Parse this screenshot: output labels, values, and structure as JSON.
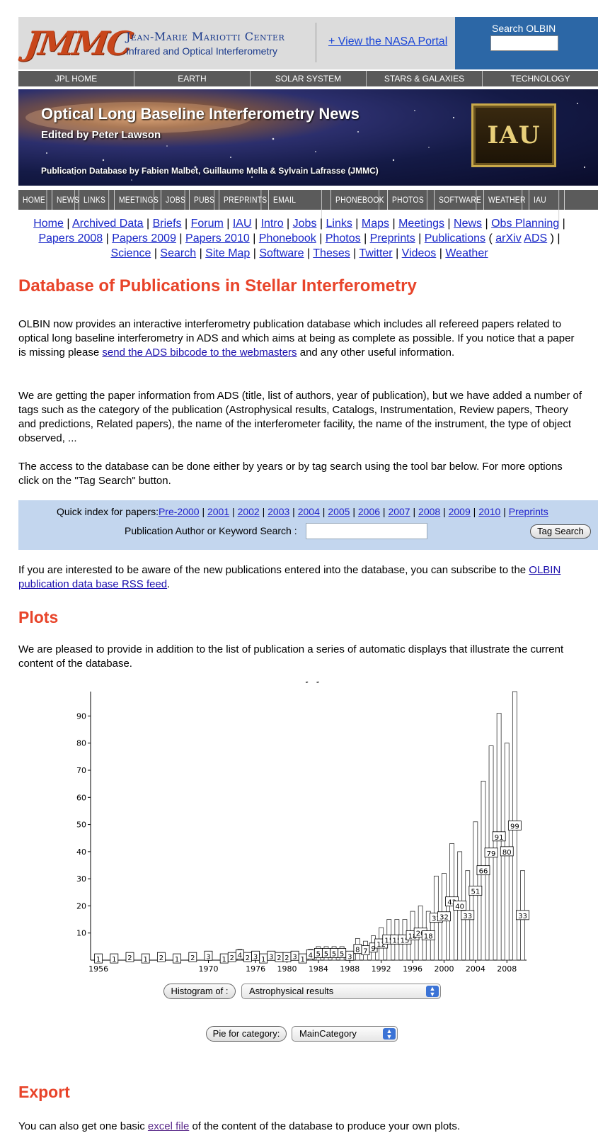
{
  "header": {
    "logo": "JMMC",
    "center_name": "Jean-Marie Mariotti Center",
    "center_subtitle": "Infrared and Optical Interferometry",
    "nasa_link": "+ View the NASA Portal",
    "search_label": "Search OLBIN"
  },
  "top_nav": [
    "JPL HOME",
    "EARTH",
    "SOLAR SYSTEM",
    "STARS & GALAXIES",
    "TECHNOLOGY"
  ],
  "banner": {
    "title": "Optical Long Baseline Interferometry News",
    "editor": "Edited by Peter Lawson",
    "publication_credit": "Publication Database by Fabien Malbet, Guillaume Mella & Sylvain Lafrasse (JMMC)",
    "badge": "IAU"
  },
  "nav2": [
    "HOME",
    "NEWS",
    "LINKS",
    "MEETINGS",
    "JOBS",
    "PUBS",
    "PREPRINTS",
    "EMAIL FORUM",
    "PHONEBOOK",
    "PHOTOS",
    "SOFTWARE",
    "WEATHER",
    "IAU WG"
  ],
  "quick_links": {
    "line1": [
      "Home",
      "Archived Data",
      "Briefs",
      "Forum",
      "IAU",
      "Intro",
      "Jobs",
      "Links",
      "Maps",
      "Meetings",
      "News",
      "Obs Planning"
    ],
    "line2": [
      "Papers 2008",
      "Papers 2009",
      "Papers 2010",
      "Phonebook",
      "Photos",
      "Preprints",
      "Publications"
    ],
    "line2_sub": [
      "arXiv",
      "ADS"
    ],
    "line3": [
      "Science",
      "Search",
      "Site Map",
      "Software",
      "Theses",
      "Twitter",
      "Videos",
      "Weather"
    ]
  },
  "main": {
    "title": "Database of Publications in Stellar Interferometry",
    "p1_before": "OLBIN now provides an interactive interferometry publication database which includes all refereed papers related to optical long baseline interferometry in ADS and which aims at being as complete as possible. If you notice that a paper is missing please ",
    "p1_link": "send the ADS bibcode to the webmasters",
    "p1_after": " and any other useful information.",
    "p2": "We are getting the paper information from ADS (title, list of authors, year of publication), but we have added a number of tags such as the category of the publication (Astrophysical results, Catalogs, Instrumentation, Review papers, Theory and predictions, Related papers), the name of the interferometer facility, the name of the instrument, the type of object observed, ...",
    "p3": "The access to the database can be done either by years or by tag search using the tool bar below. For more options click on the \"Tag Search\" button.",
    "toolbar": {
      "quick_index_label": "Quick index for papers:",
      "years": [
        "Pre-2000",
        "2001",
        "2002",
        "2003",
        "2004",
        "2005",
        "2006",
        "2007",
        "2008",
        "2009",
        "2010",
        "Preprints"
      ],
      "search_label": "Publication Author or Keyword Search :",
      "tag_search_button": "Tag Search"
    },
    "p4_before": "If you are interested to be aware of the new publications entered into the database, you can subscribe to the ",
    "p4_link": "OLBIN publication data base RSS feed",
    "p4_after": ".",
    "plots_title": "Plots",
    "p5": "We are pleased to provide in addition to the list of publication a series of automatic displays that illustrate the current content of the database.",
    "histogram_button": "Histogram of :",
    "histogram_select": "Astrophysical results",
    "pie_button": "Pie for category:",
    "pie_select": "MainCategory",
    "export_title": "Export",
    "p6_before": "You can also get one basic ",
    "p6_link": "excel file",
    "p6_after": " of the content of the database to produce your own plots."
  },
  "chart_data": {
    "type": "bar",
    "title": "Articles by years",
    "x": [
      1956,
      1958,
      1960,
      1962,
      1964,
      1966,
      1968,
      1970,
      1972,
      1973,
      1974,
      1975,
      1976,
      1977,
      1978,
      1979,
      1980,
      1981,
      1982,
      1983,
      1984,
      1985,
      1986,
      1987,
      1988,
      1989,
      1990,
      1991,
      1992,
      1993,
      1994,
      1995,
      1996,
      1997,
      1998,
      1999,
      2000,
      2001,
      2002,
      2003,
      2004,
      2005,
      2006,
      2007,
      2008,
      2009,
      2010
    ],
    "values": [
      1,
      1,
      2,
      1,
      2,
      1,
      2,
      3,
      1,
      2,
      4,
      2,
      3,
      1,
      3,
      2,
      2,
      3,
      1,
      4,
      5,
      5,
      5,
      5,
      3,
      8,
      7,
      9,
      12,
      15,
      15,
      15,
      18,
      20,
      18,
      31,
      32,
      43,
      40,
      33,
      51,
      66,
      79,
      91,
      80,
      99,
      33
    ],
    "xticks": [
      1956,
      1970,
      1976,
      1980,
      1984,
      1988,
      1992,
      1996,
      2000,
      2004,
      2008
    ],
    "yticks": [
      10,
      20,
      30,
      40,
      50,
      60,
      70,
      80,
      90
    ],
    "ylim": [
      0,
      99
    ],
    "grid": false,
    "legend": "none"
  }
}
